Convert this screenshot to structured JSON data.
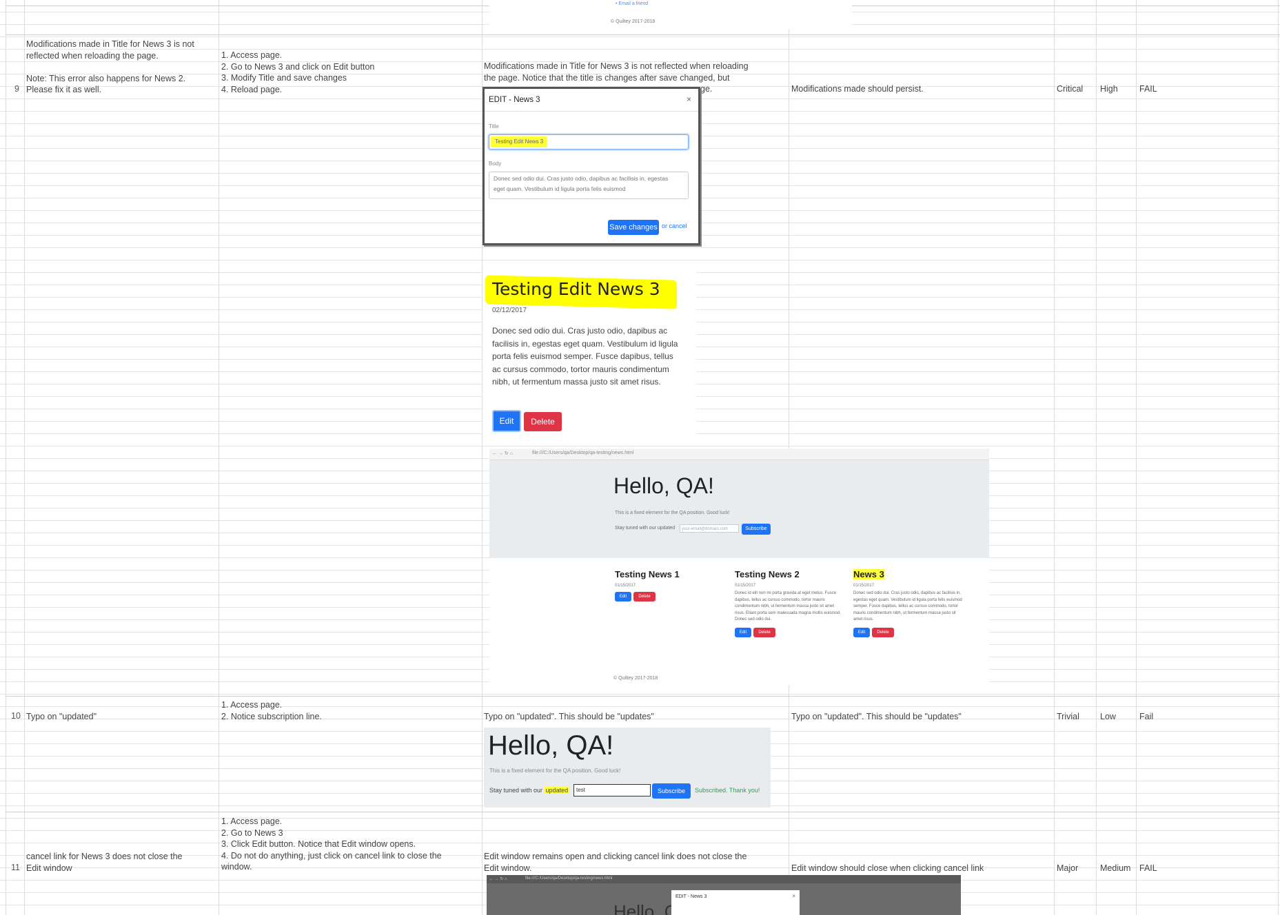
{
  "rows": [
    {
      "number": "9",
      "summary": "Modifications made in Title for News 3 is not\nreflected when reloading the page.\n\nNote: This error also happens for News 2.\nPlease fix it as well.",
      "steps": "1. Access page.\n2. Go to News 3 and click on Edit button\n3. Modify Title and save changes\n4. Reload page.",
      "actual": "Modifications made in Title for News 3 is not reflected when reloading\nthe page. Notice that the title is changes after save changed, but",
      "actual_tail": "ge.",
      "expected": "Modifications made should persist.",
      "severity": "Critical",
      "priority": "High",
      "status": "FAIL"
    },
    {
      "number": "10",
      "summary": "Typo on  \"updated\"",
      "steps": "1. Access page.\n2. Notice subscription line.",
      "actual": "Typo on  \"updated\". This should be \"updates\"",
      "expected": "Typo on  \"updated\". This should be \"updates\"",
      "severity": "Trivial",
      "priority": "Low",
      "status": "Fail"
    },
    {
      "number": "11",
      "summary": "cancel link for News 3 does not close the\nEdit window",
      "steps": "1. Access page.\n2. Go to News 3\n3. Click Edit button. Notice that Edit window opens.\n4. Do not do anything, just click on cancel link to close the\nwindow.",
      "actual": "Edit window remains open and clicking cancel link does not close the\nEdit window.",
      "expected": "Edit window should close when clicking cancel link",
      "severity": "Major",
      "priority": "Medium",
      "status": "FAIL"
    }
  ],
  "top_fragment": {
    "link": "• Email a friend",
    "footer": "© Quiltey 2017-2018"
  },
  "modal_shot": {
    "title": "EDIT - News 3",
    "close": "×",
    "title_label": "Title",
    "title_value": "Testing Edit News 3",
    "body_label": "Body",
    "body_value": "Donec sed odio dui. Cras justo odio, dapibus ac facilisis in, egestas eget quam. Vestibulum id ligula porta felis euismod",
    "save": "Save changes",
    "cancel": "or cancel"
  },
  "card_shot": {
    "title": "Testing Edit News 3",
    "date": "02/12/2017",
    "body": "Donec sed odio dui. Cras justo odio, dapibus ac facilisis in, egestas eget quam. Vestibulum id ligula porta felis euismod semper. Fusce dapibus, tellus ac cursus commodo, tortor mauris condimentum nibh, ut fermentum massa justo sit amet risus.",
    "edit": "Edit",
    "delete": "Delete"
  },
  "home_shot": {
    "url": "file:///C:/Users/qa/Desktop/qa-testing/news.html",
    "hello": "Hello, QA!",
    "lead": "This is a fixed element for the QA position. Good luck!",
    "stay": "Stay tuned with our updated",
    "email_placeholder": "your-email@domain.com",
    "subscribe": "Subscribe",
    "news": [
      {
        "title": "Testing News 1",
        "date": "01/15/2017",
        "body": "",
        "highlight": false
      },
      {
        "title": "Testing News 2",
        "date": "01/15/2017",
        "body": "Donec id elit non mi porta gravida at eget metus. Fusce dapibus, tellus ac cursus commodo, tortor mauris condimentum nibh, ut fermentum massa justo sit amet risus. Etiam porta sem malesuada magna mollis euismod. Donec sed odio dui.",
        "highlight": false
      },
      {
        "title": "News 3",
        "date": "01/15/2017",
        "body": "Donec sed odio dui. Cras justo odio, dapibus ac facilisis in, egestas eget quam. Vestibulum id ligula porta felis euismod semper. Fusce dapibus, tellus ac cursus commodo, tortor mauris condimentum nibh, ut fermentum massa justo sit amet risus.",
        "highlight": true
      }
    ],
    "edit": "Edit",
    "delete": "Delete",
    "footer": "© Quiltey 2017-2018"
  },
  "typo_shot": {
    "hello": "Hello, QA!",
    "lead": "This is a fixed element for the QA position. Good luck!",
    "stay_prefix": "Stay tuned with our ",
    "stay_highlight": "updated",
    "email_value": "test",
    "subscribe": "Subscribe",
    "result": "Subscribed. Thank you!"
  },
  "dark_shot": {
    "url": "file:///C:/Users/qa/Desktop/qa-testing/news.html",
    "hello": "Hello, QA!",
    "modal_title": "EDIT - News 3",
    "close": "×"
  }
}
